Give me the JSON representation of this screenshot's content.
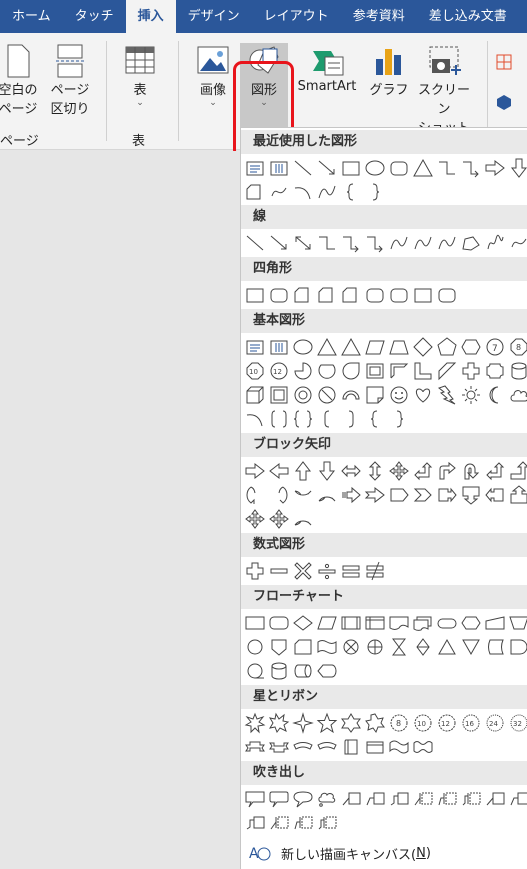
{
  "tabs": [
    "ホーム",
    "タッチ",
    "挿入",
    "デザイン",
    "レイアウト",
    "参考資料",
    "差し込み文書"
  ],
  "active_tab_index": 2,
  "ribbon": {
    "blank_page": [
      "空白の",
      "ページ"
    ],
    "page_break": [
      "ページ",
      "区切り"
    ],
    "group_pages": "ページ",
    "table": "表",
    "group_table": "表",
    "pictures": "画像",
    "shapes": "図形",
    "smartart": "SmartArt",
    "chart": "グラフ",
    "screenshot": [
      "スクリーン",
      "ショット"
    ],
    "chevron": "⌄"
  },
  "sections": {
    "recent": "最近使用した図形",
    "lines": "線",
    "rectangles": "四角形",
    "basic": "基本図形",
    "block_arrows": "ブロック矢印",
    "equation": "数式図形",
    "flowchart": "フローチャート",
    "stars": "星とリボン",
    "callouts": "吹き出し"
  },
  "canvas": {
    "label_main": "新しい描画キャンバス(",
    "label_key": "N",
    "label_end": ")"
  },
  "colors": {
    "accent": "#2b579a",
    "highlight": "#e8141b"
  }
}
